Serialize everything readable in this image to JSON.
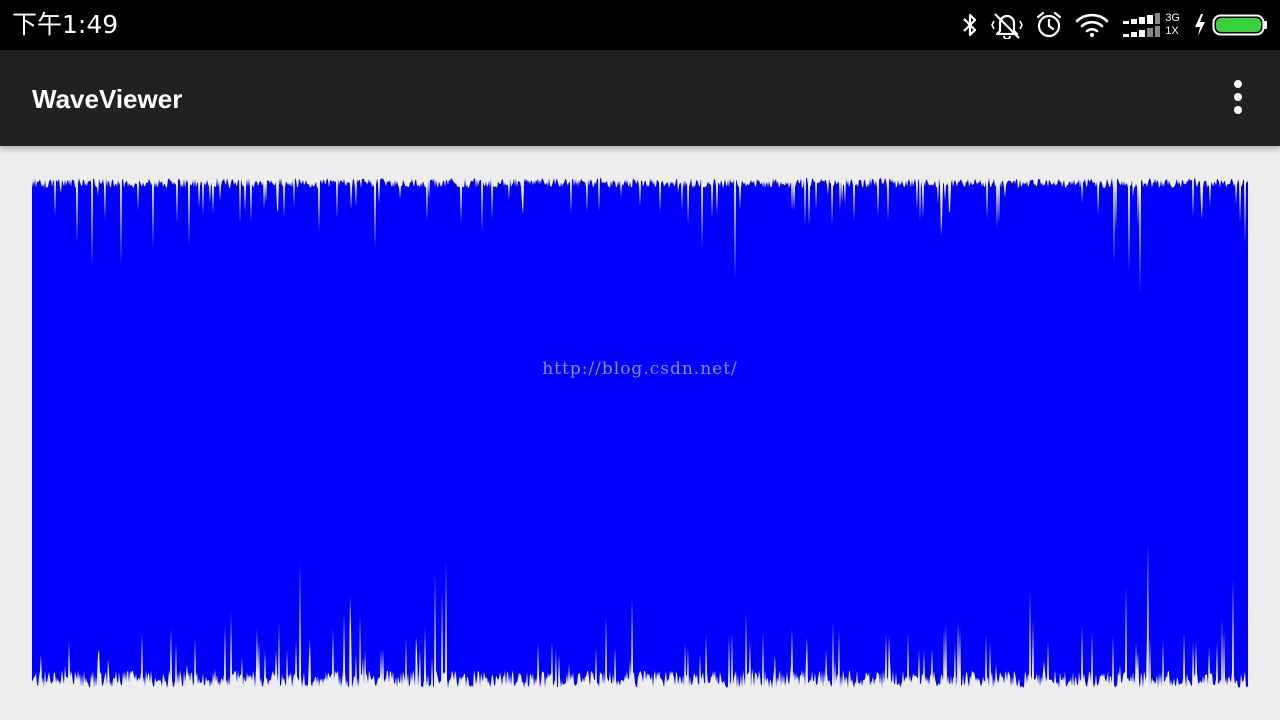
{
  "status_bar": {
    "time": "下午1:49",
    "network_type_top": "3G",
    "network_type_bottom": "1X",
    "icons": [
      "bluetooth-icon",
      "vibrate-icon",
      "alarm-icon",
      "wifi-icon",
      "signal-icon",
      "charging-icon",
      "battery-icon"
    ]
  },
  "app_bar": {
    "title": "WaveViewer",
    "overflow_icon": "more-vert-icon"
  },
  "waveform": {
    "color": "#0000ff",
    "background": "#eeeeee"
  },
  "watermark": "http://blog.csdn.net/"
}
